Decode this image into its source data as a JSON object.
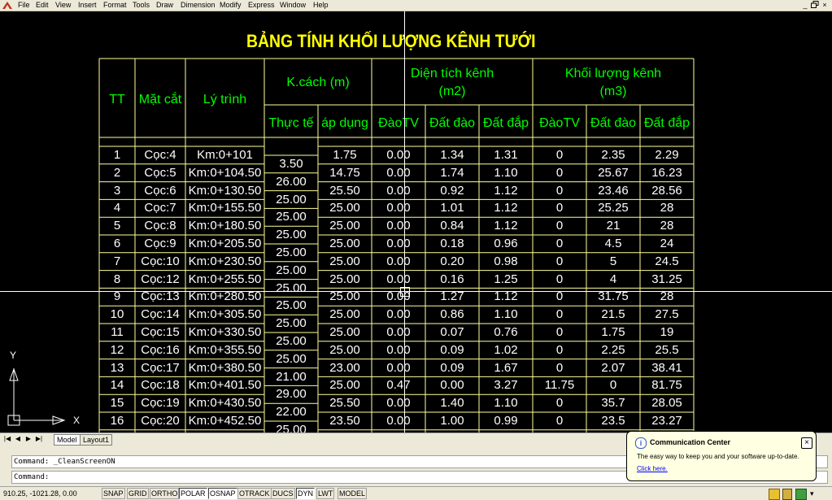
{
  "menu": [
    "File",
    "Edit",
    "View",
    "Insert",
    "Format",
    "Tools",
    "Draw",
    "Dimension",
    "Modify",
    "Express",
    "Window",
    "Help"
  ],
  "window_controls": [
    "_",
    "ð",
    "×"
  ],
  "drawing": {
    "title": "BẢNG TÍNH KHỐI LƯỢNG KÊNH TƯỚI",
    "headers": {
      "tt": "TT",
      "mat_cat": "Mặt cắt",
      "ly_trinh": "Lý trình",
      "k_cach": "K.cách (m)",
      "thuc_te": "Thực tế",
      "ap_dung": "áp dụng",
      "dien_tich_l1": "Diện tích kênh",
      "dien_tich_l2": "(m2)",
      "khoi_luong_l1": "Khối lượng kênh",
      "khoi_luong_l2": "(m3)",
      "dao_tv_1": "ĐàoTV",
      "dat_dao_1": "Đất đào",
      "dat_dap_1": "Đất đắp",
      "dao_tv_2": "ĐàoTV",
      "dat_dao_2": "Đất đào",
      "dat_dap_2": "Đất đắp"
    },
    "rows": [
      [
        "1",
        "Cọc:4",
        "Km:0+101",
        "1.75",
        "0.00",
        "1.34",
        "1.31",
        "0",
        "2.35",
        "2.29"
      ],
      [
        "2",
        "Cọc:5",
        "Km:0+104.50",
        "14.75",
        "0.00",
        "1.74",
        "1.10",
        "0",
        "25.67",
        "16.23"
      ],
      [
        "3",
        "Cọc:6",
        "Km:0+130.50",
        "25.50",
        "0.00",
        "0.92",
        "1.12",
        "0",
        "23.46",
        "28.56"
      ],
      [
        "4",
        "Cọc:7",
        "Km:0+155.50",
        "25.00",
        "0.00",
        "1.01",
        "1.12",
        "0",
        "25.25",
        "28"
      ],
      [
        "5",
        "Cọc:8",
        "Km:0+180.50",
        "25.00",
        "0.00",
        "0.84",
        "1.12",
        "0",
        "21",
        "28"
      ],
      [
        "6",
        "Cọc:9",
        "Km:0+205.50",
        "25.00",
        "0.00",
        "0.18",
        "0.96",
        "0",
        "4.5",
        "24"
      ],
      [
        "7",
        "Cọc:10",
        "Km:0+230.50",
        "25.00",
        "0.00",
        "0.20",
        "0.98",
        "0",
        "5",
        "24.5"
      ],
      [
        "8",
        "Cọc:12",
        "Km:0+255.50",
        "25.00",
        "0.00",
        "0.16",
        "1.25",
        "0",
        "4",
        "31.25"
      ],
      [
        "9",
        "Cọc:13",
        "Km:0+280.50",
        "25.00",
        "0.00",
        "1.27",
        "1.12",
        "0",
        "31.75",
        "28"
      ],
      [
        "10",
        "Cọc:14",
        "Km:0+305.50",
        "25.00",
        "0.00",
        "0.86",
        "1.10",
        "0",
        "21.5",
        "27.5"
      ],
      [
        "11",
        "Cọc:15",
        "Km:0+330.50",
        "25.00",
        "0.00",
        "0.07",
        "0.76",
        "0",
        "1.75",
        "19"
      ],
      [
        "12",
        "Cọc:16",
        "Km:0+355.50",
        "25.00",
        "0.00",
        "0.09",
        "1.02",
        "0",
        "2.25",
        "25.5"
      ],
      [
        "13",
        "Cọc:17",
        "Km:0+380.50",
        "23.00",
        "0.00",
        "0.09",
        "1.67",
        "0",
        "2.07",
        "38.41"
      ],
      [
        "14",
        "Cọc:18",
        "Km:0+401.50",
        "25.00",
        "0.47",
        "0.00",
        "3.27",
        "11.75",
        "0",
        "81.75"
      ],
      [
        "15",
        "Cọc:19",
        "Km:0+430.50",
        "25.50",
        "0.00",
        "1.40",
        "1.10",
        "0",
        "35.7",
        "28.05"
      ],
      [
        "16",
        "Cọc:20",
        "Km:0+452.50",
        "23.50",
        "0.00",
        "1.00",
        "0.99",
        "0",
        "23.5",
        "23.27"
      ]
    ],
    "thuc_te_values": [
      "3.50",
      "26.00",
      "25.00",
      "25.00",
      "25.00",
      "25.00",
      "25.00",
      "25.00",
      "25.00",
      "25.00",
      "25.00",
      "25.00",
      "21.00",
      "29.00",
      "22.00",
      "25.00"
    ],
    "ucs": {
      "y": "Y",
      "x": "X"
    }
  },
  "tabs": [
    "Model",
    "Layout1"
  ],
  "command": {
    "line1": "Command:  _CleanScreenON",
    "line2": "Command:"
  },
  "status": {
    "coords": "910.25, -1021.28, 0.00",
    "buttons": [
      "SNAP",
      "GRID",
      "ORTHO",
      "POLAR",
      "OSNAP",
      "OTRACK",
      "DUCS",
      "DYN",
      "LWT",
      "MODEL"
    ]
  },
  "balloon": {
    "title": "Communication Center",
    "text": "The easy way to keep you and your software up-to-date.",
    "link": "Click here.",
    "close": "×",
    "info": "i"
  },
  "colors": {
    "table_text": "#ffffff",
    "header": "#00ff00",
    "title": "#ffff00",
    "grid": "#ffff99"
  }
}
